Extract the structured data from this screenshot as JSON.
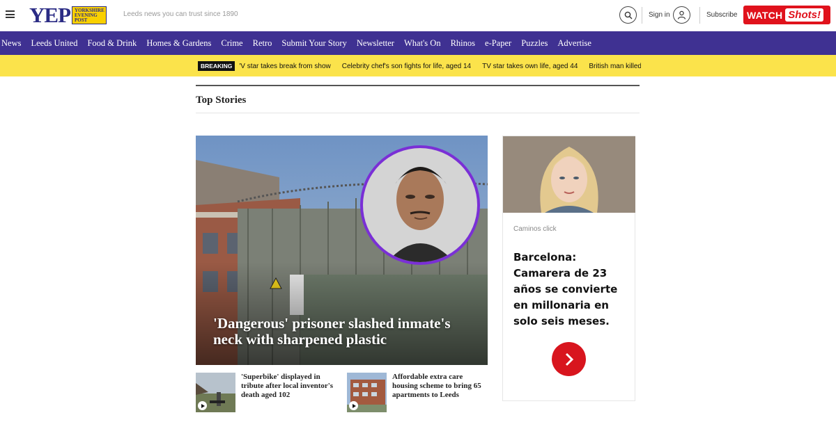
{
  "header": {
    "logo_text": "YEP",
    "logo_badge": "Yorkshire Evening Post",
    "tagline": "Leeds news you can trust since 1890",
    "signin_label": "Sign in",
    "subscribe_label": "Subscribe",
    "watch_label": "WATCH",
    "shots_label": "Shots!"
  },
  "nav": {
    "items": [
      "News",
      "Leeds United",
      "Food & Drink",
      "Homes & Gardens",
      "Crime",
      "Retro",
      "Submit Your Story",
      "Newsletter",
      "What's On",
      "Rhinos",
      "e-Paper",
      "Puzzles",
      "Advertise"
    ]
  },
  "breaking": {
    "label": "BREAKING",
    "items": [
      "'V star takes break from show",
      "Celebrity chef's son fights for life, aged 14",
      "TV star takes own life, aged 44",
      "British man killed o"
    ]
  },
  "section": {
    "title": "Top Stories"
  },
  "hero": {
    "headline": "'Dangerous' prisoner slashed inmate's neck with sharpened plastic"
  },
  "stories": [
    {
      "title": "'Superbike' displayed in tribute after local inventor's death aged 102"
    },
    {
      "title": "Affordable extra care housing scheme to bring 65 apartments to Leeds"
    }
  ],
  "ad": {
    "sponsor": "Caminos click",
    "title": "Barcelona: Camarera de 23 años se convierte en millonaria en solo seis meses."
  },
  "colors": {
    "nav_bg": "#3f3192",
    "breaking_bg": "#fbe34b",
    "watch_red": "#e0121c",
    "accent_purple": "#7a2fd6"
  }
}
